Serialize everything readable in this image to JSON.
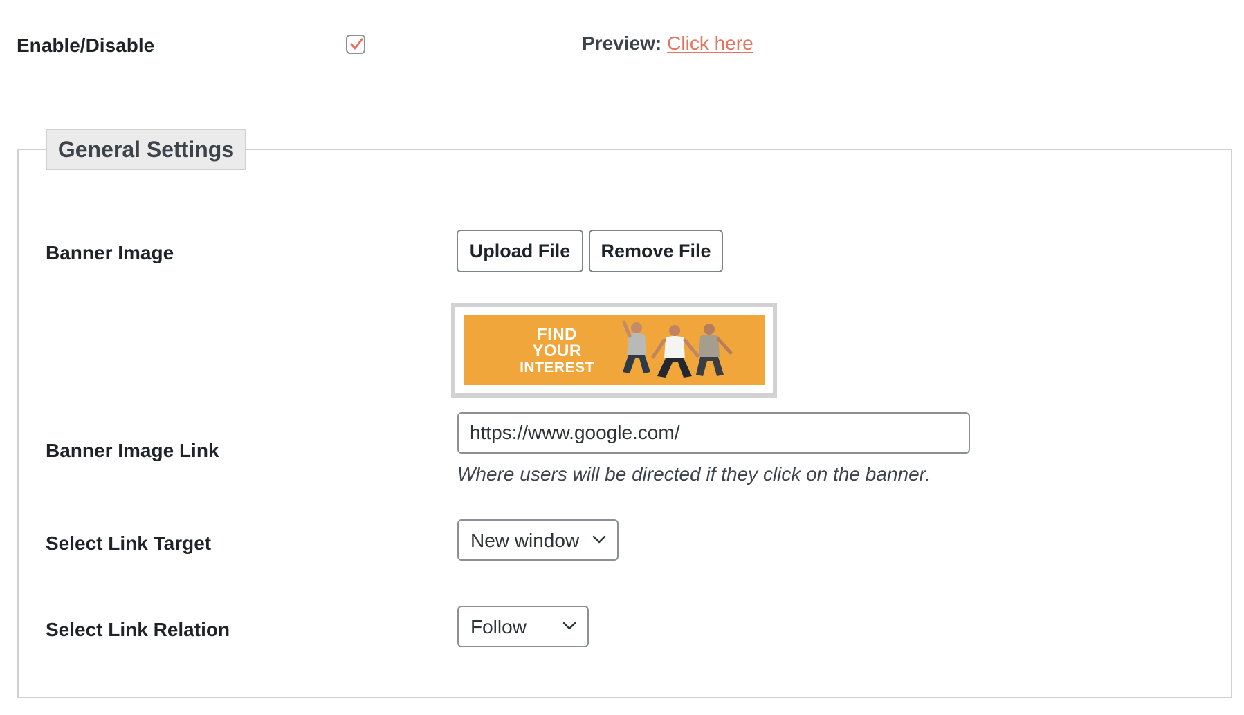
{
  "enable": {
    "label": "Enable/Disable",
    "checked": true
  },
  "preview": {
    "label": "Preview:",
    "link_text": "Click here"
  },
  "section": {
    "title": "General Settings"
  },
  "banner_image": {
    "label": "Banner Image",
    "upload_label": "Upload File",
    "remove_label": "Remove File",
    "banner_text": [
      "FIND",
      "YOUR",
      "INTEREST"
    ]
  },
  "banner_link": {
    "label": "Banner Image Link",
    "value": "https://www.google.com/",
    "hint": "Where users will be directed if they click on the banner."
  },
  "link_target": {
    "label": "Select Link Target",
    "selected": "New window"
  },
  "link_relation": {
    "label": "Select Link Relation",
    "selected": "Follow"
  },
  "colors": {
    "accent_link": "#e8735e",
    "banner_bg": "#f0a63a",
    "checkmark": "#e8735e"
  },
  "icons": {
    "checkbox": "checkmark-icon",
    "select_arrow": "chevron-down-icon"
  }
}
